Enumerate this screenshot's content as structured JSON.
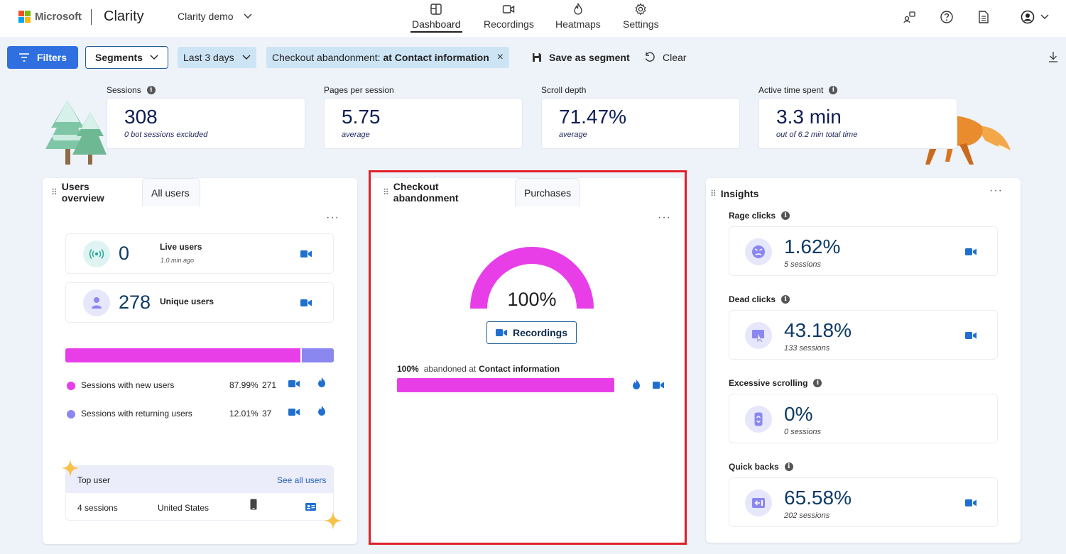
{
  "header": {
    "company": "Microsoft",
    "product": "Clarity",
    "project": "Clarity demo",
    "nav": [
      {
        "label": "Dashboard",
        "icon": "dashboard-icon",
        "active": true
      },
      {
        "label": "Recordings",
        "icon": "camera-icon",
        "active": false
      },
      {
        "label": "Heatmaps",
        "icon": "flame-icon",
        "active": false
      },
      {
        "label": "Settings",
        "icon": "gear-icon",
        "active": false
      }
    ]
  },
  "filterbar": {
    "filters_label": "Filters",
    "segments_label": "Segments",
    "date_range": "Last 3 days",
    "active_filter_prefix": "Checkout abandonment: ",
    "active_filter_value": "at Contact information",
    "save_segment_label": "Save as segment",
    "clear_label": "Clear"
  },
  "metrics": [
    {
      "label": "Sessions",
      "value": "308",
      "sub": "0 bot sessions excluded"
    },
    {
      "label": "Pages per session",
      "value": "5.75",
      "sub": "average"
    },
    {
      "label": "Scroll depth",
      "value": "71.47%",
      "sub": "average"
    },
    {
      "label": "Active time spent",
      "value": "3.3 min",
      "sub": "out of 6.2 min total time"
    }
  ],
  "users_panel": {
    "tab_active": "Users overview",
    "tab_inactive": "All users",
    "live": {
      "value": "0",
      "label": "Live users",
      "sub": "1.0 min ago"
    },
    "unique": {
      "value": "278",
      "label": "Unique users"
    },
    "split": {
      "new_fraction": 0.8799,
      "returning_fraction": 0.1201
    },
    "legend": [
      {
        "label": "Sessions with new users",
        "percent": "87.99%",
        "count": "271",
        "color": "#e83ee8"
      },
      {
        "label": "Sessions with returning users",
        "percent": "12.01%",
        "count": "37",
        "color": "#8b87f0"
      }
    ],
    "top_user": {
      "title": "Top user",
      "link": "See all users",
      "sessions": "4 sessions",
      "country": "United States"
    }
  },
  "checkout_panel": {
    "tab_active": "Checkout abandonment",
    "tab_inactive": "Purchases",
    "gauge_value": "100%",
    "gauge_fraction": 1.0,
    "recordings_label": "Recordings",
    "step_percent": "100%",
    "step_text": "abandoned at",
    "step_name": "Contact information",
    "step_fraction": 1.0,
    "accent": "#e83ee8"
  },
  "insights": {
    "title": "Insights",
    "items": [
      {
        "label": "Rage clicks",
        "value": "1.62%",
        "sub": "5 sessions",
        "icon": "angry-face-icon"
      },
      {
        "label": "Dead clicks",
        "value": "43.18%",
        "sub": "133 sessions",
        "icon": "dead-click-icon"
      },
      {
        "label": "Excessive scrolling",
        "value": "0%",
        "sub": "0 sessions",
        "icon": "scroll-icon"
      },
      {
        "label": "Quick backs",
        "value": "65.58%",
        "sub": "202 sessions",
        "icon": "quick-back-icon"
      }
    ]
  },
  "colors": {
    "brand_blue": "#2f6fe0",
    "video_blue": "#1f6fd0",
    "magenta": "#e83ee8",
    "lavender": "#8b87f0",
    "highlight_red": "#e0202a"
  }
}
